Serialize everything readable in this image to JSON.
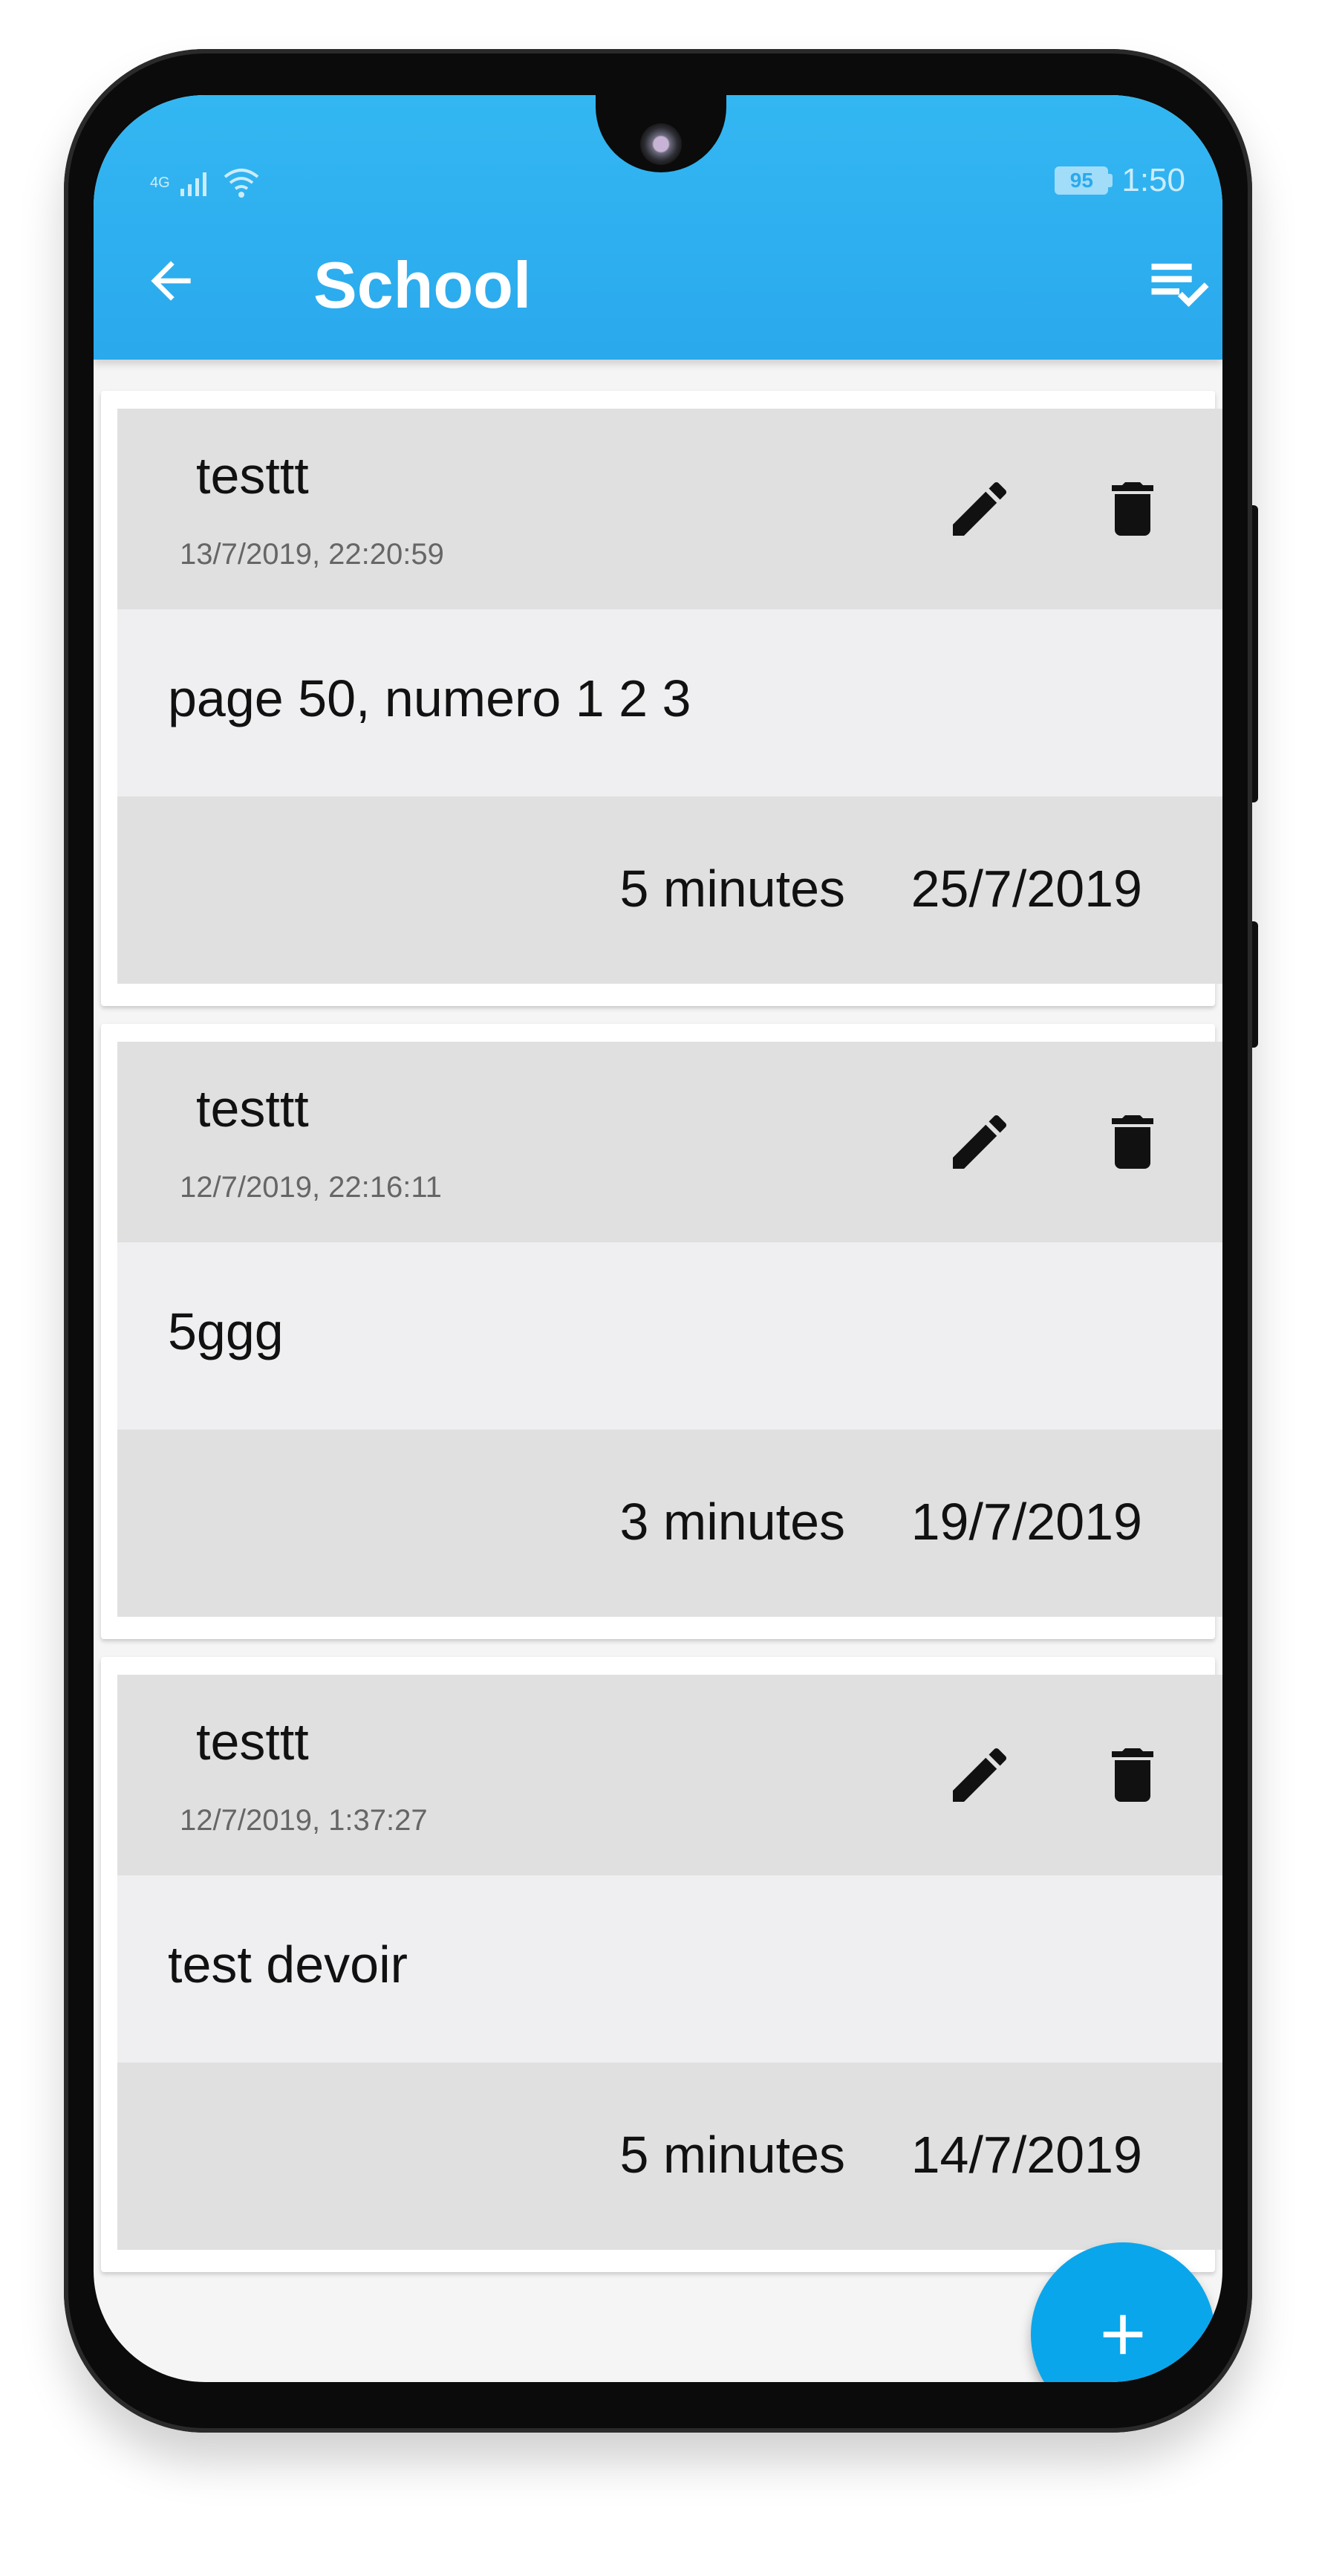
{
  "status_bar": {
    "signal_label": "4G",
    "battery_level": "95",
    "time": "1:50"
  },
  "header": {
    "title": "School",
    "back_icon": "arrow-left-icon",
    "action_icon": "playlist-check-icon"
  },
  "homework_items": [
    {
      "title": "testtt",
      "created": "13/7/2019, 22:20:59",
      "description": "page 50, numero 1 2 3",
      "duration": "5 minutes",
      "due_date": "25/7/2019"
    },
    {
      "title": "testtt",
      "created": "12/7/2019, 22:16:11",
      "description": "5ggg",
      "duration": "3 minutes",
      "due_date": "19/7/2019"
    },
    {
      "title": "testtt",
      "created": "12/7/2019, 1:37:27",
      "description": "test devoir",
      "duration": "5 minutes",
      "due_date": "14/7/2019"
    }
  ],
  "fab": {
    "icon": "plus-icon"
  },
  "colors": {
    "app_bar": "#2aa9ed",
    "fab": "#0aa6ec",
    "card_header": "#e0e0e0",
    "card_body": "#efeef0"
  }
}
